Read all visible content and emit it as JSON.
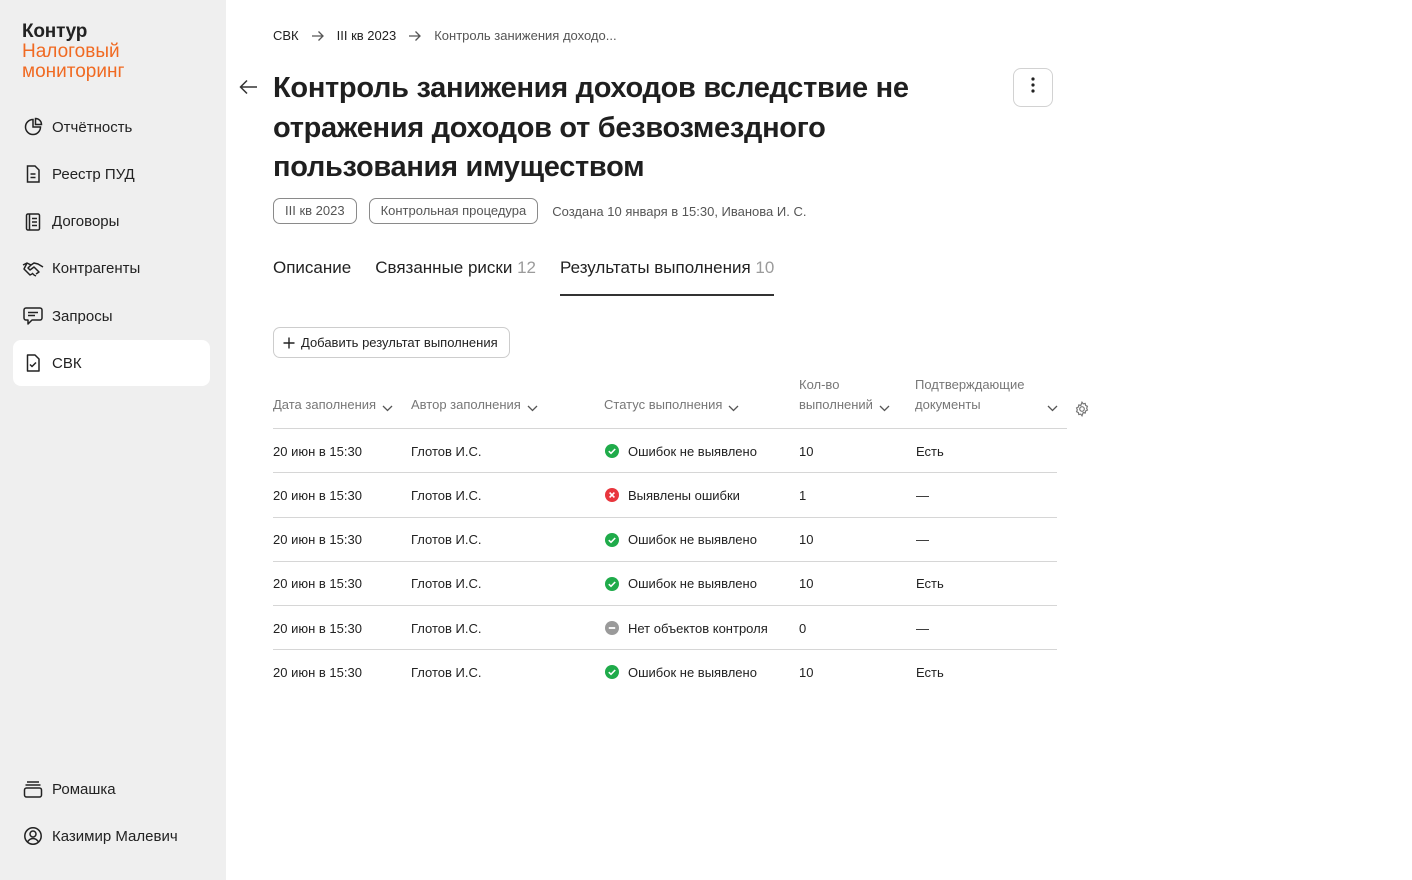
{
  "logo": {
    "brand": "Контур",
    "product_line1": "Налоговый",
    "product_line2": "мониторинг"
  },
  "nav": [
    {
      "label": "Отчётность",
      "icon": "pie-chart-icon"
    },
    {
      "label": "Реестр ПУД",
      "icon": "document-icon"
    },
    {
      "label": "Договоры",
      "icon": "notebook-icon"
    },
    {
      "label": "Контрагенты",
      "icon": "handshake-icon"
    },
    {
      "label": "Запросы",
      "icon": "chat-icon"
    },
    {
      "label": "СВК",
      "icon": "document-check-icon",
      "active": true
    }
  ],
  "nav_bottom": [
    {
      "label": "Ромашка",
      "icon": "organization-icon"
    },
    {
      "label": "Казимир Малевич",
      "icon": "user-icon"
    }
  ],
  "breadcrumb": [
    "СВК",
    "III кв 2023",
    "Контроль занижения доходо..."
  ],
  "title": "Контроль занижения доходов вследствие не отражения доходов от безвозмездного пользования имуществом",
  "tags": [
    "III кв 2023",
    "Контрольная процедура"
  ],
  "meta_text": "Создана 10 января в 15:30, Иванова И. С.",
  "tabs": [
    {
      "label": "Описание",
      "count": ""
    },
    {
      "label": "Связанные риски",
      "count": "12"
    },
    {
      "label": "Результаты выполнения",
      "count": "10",
      "active": true
    }
  ],
  "add_button_label": "Добавить результат выполнения",
  "table": {
    "headers": {
      "date": "Дата заполнения",
      "author": "Автор заполнения",
      "status": "Статус выполнения",
      "count_line1": "Кол-во",
      "count_line2": "выполнений",
      "docs_line1": "Подтверждающие",
      "docs_line2": "документы"
    },
    "rows": [
      {
        "date": "20 июн в 15:30",
        "author": "Глотов И.С.",
        "status": "Ошибок не выявлено",
        "status_type": "success",
        "count": "10",
        "docs": "Есть"
      },
      {
        "date": "20 июн в 15:30",
        "author": "Глотов И.С.",
        "status": "Выявлены ошибки",
        "status_type": "error",
        "count": "1",
        "docs": "—"
      },
      {
        "date": "20 июн в 15:30",
        "author": "Глотов И.С.",
        "status": "Ошибок не выявлено",
        "status_type": "success",
        "count": "10",
        "docs": "—"
      },
      {
        "date": "20 июн в 15:30",
        "author": "Глотов И.С.",
        "status": "Ошибок не выявлено",
        "status_type": "success",
        "count": "10",
        "docs": "Есть"
      },
      {
        "date": "20 июн в 15:30",
        "author": "Глотов И.С.",
        "status": "Нет объектов контроля",
        "status_type": "none",
        "count": "0",
        "docs": "—"
      },
      {
        "date": "20 июн в 15:30",
        "author": "Глотов И.С.",
        "status": "Ошибок не выявлено",
        "status_type": "success",
        "count": "10",
        "docs": "Есть"
      }
    ]
  },
  "colors": {
    "brand_orange": "#f06a22",
    "success": "#1fab4a",
    "error": "#e8363d",
    "neutral": "#9a9a9a",
    "sidebar_bg": "#efefef"
  }
}
